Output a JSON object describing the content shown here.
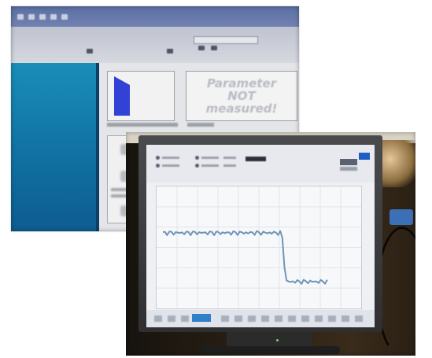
{
  "back_photo": {
    "status_box": {
      "line1": "Parameter",
      "line2": "NOT",
      "line3": "measured!"
    },
    "colors": {
      "sidebar": "#1276a6",
      "gauge_bar": "#3342d6",
      "window_background": "#e4e5e8"
    }
  },
  "front_photo": {
    "screen_chart": {
      "type": "line",
      "series_color": "#6e95b8",
      "trend": "steady level, then a sharp drop to a lower level at about 60% of the time axis",
      "y_levels_relative": {
        "before_drop": 0.62,
        "after_drop": 0.22
      },
      "drop_position_fraction": 0.62,
      "gridlines": true
    }
  }
}
